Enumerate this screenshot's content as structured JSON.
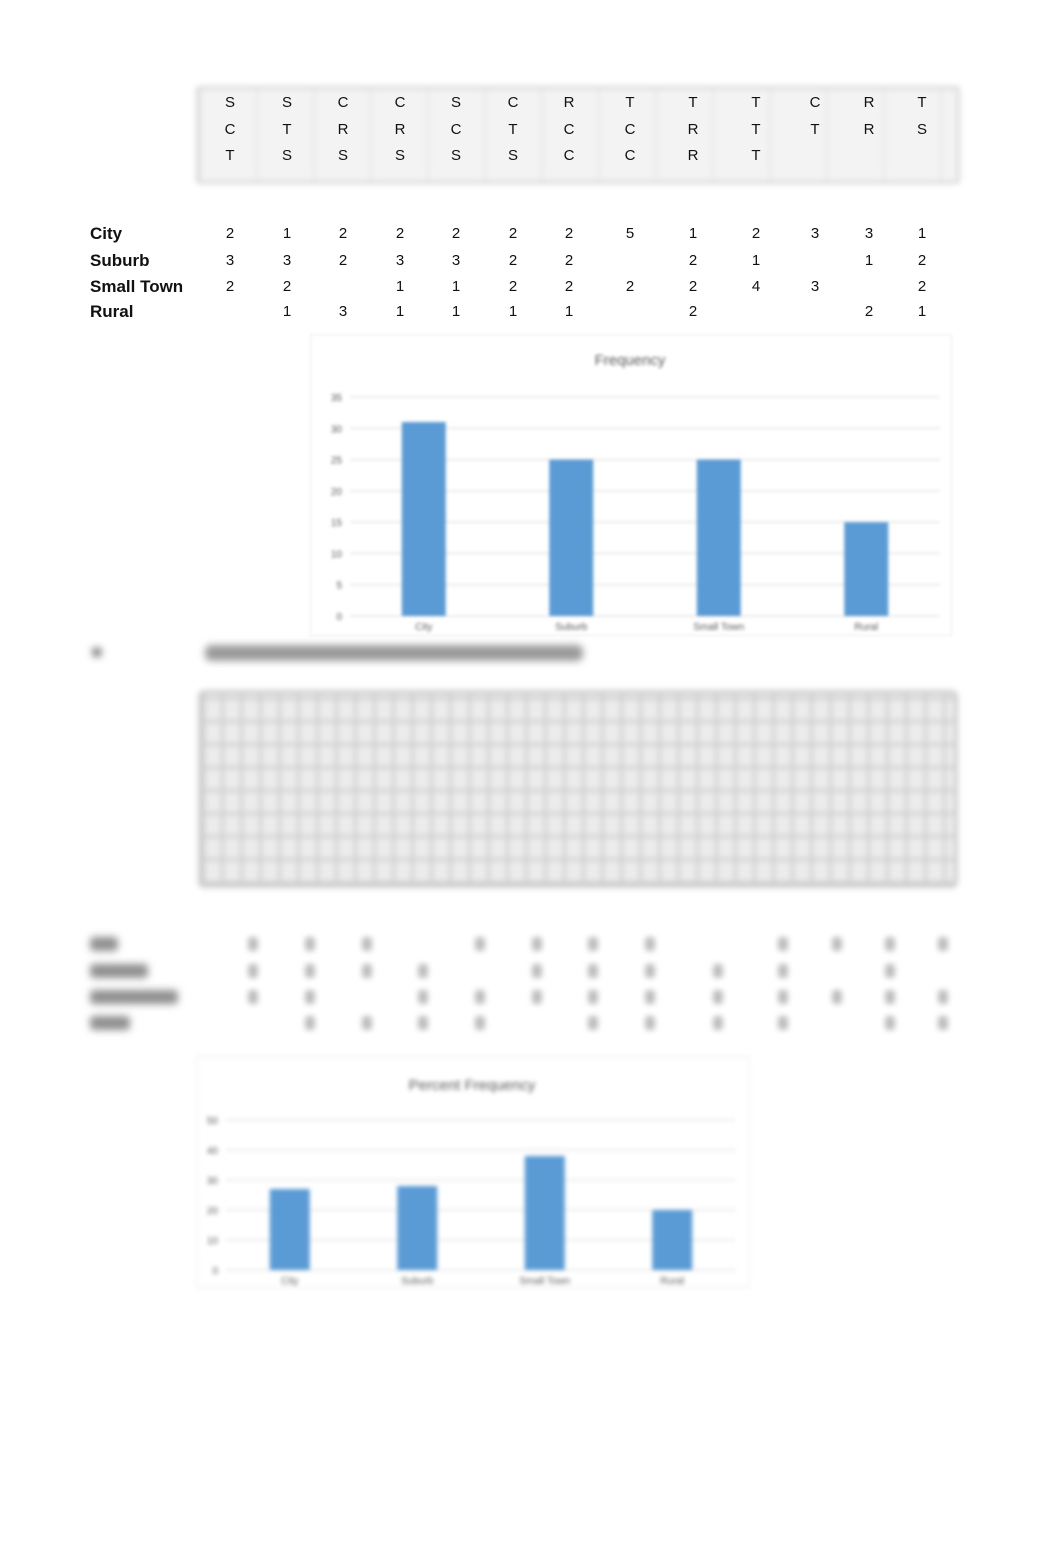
{
  "letter_grid": {
    "rows": [
      [
        "S",
        "S",
        "C",
        "C",
        "S",
        "C",
        "R",
        "T",
        "T",
        "T",
        "C",
        "R",
        "T"
      ],
      [
        "C",
        "T",
        "R",
        "R",
        "C",
        "T",
        "C",
        "C",
        "R",
        "T",
        "T",
        "R",
        "S"
      ],
      [
        "T",
        "S",
        "S",
        "S",
        "S",
        "S",
        "C",
        "C",
        "R",
        "T",
        "",
        "",
        ""
      ]
    ]
  },
  "count_table": {
    "rows": [
      {
        "label": "City",
        "values": [
          "2",
          "1",
          "2",
          "2",
          "2",
          "2",
          "2",
          "5",
          "1",
          "2",
          "3",
          "3",
          "1"
        ]
      },
      {
        "label": "Suburb",
        "values": [
          "3",
          "3",
          "2",
          "3",
          "3",
          "2",
          "2",
          "",
          "2",
          "1",
          "",
          "1",
          "2"
        ]
      },
      {
        "label": "Small Town",
        "values": [
          "2",
          "2",
          "",
          "1",
          "1",
          "2",
          "2",
          "2",
          "2",
          "4",
          "3",
          "",
          "2"
        ]
      },
      {
        "label": "Rural",
        "values": [
          "",
          "1",
          "3",
          "1",
          "1",
          "1",
          "1",
          "",
          "2",
          "",
          "",
          "2",
          "1"
        ]
      }
    ]
  },
  "chart_data": [
    {
      "type": "bar",
      "title": "Frequency",
      "categories": [
        "City",
        "Suburb",
        "Small Town",
        "Rural"
      ],
      "values": [
        31,
        25,
        25,
        15
      ],
      "xlabel": "",
      "ylabel": "",
      "ylim": [
        0,
        35
      ],
      "yticks": [
        0,
        5,
        10,
        15,
        20,
        25,
        30,
        35
      ],
      "grid": true,
      "color": "#5b9bd5"
    },
    {
      "type": "bar",
      "title": "Percent Frequency",
      "categories": [
        "City",
        "Suburb",
        "Small Town",
        "Rural"
      ],
      "values": [
        27,
        28,
        38,
        20
      ],
      "xlabel": "",
      "ylabel": "",
      "ylim": [
        0,
        50
      ],
      "yticks": [
        0,
        10,
        20,
        30,
        40,
        50
      ],
      "grid": true,
      "color": "#5b9bd5"
    }
  ],
  "blurred_section": {
    "count_table_labels": [
      "City",
      "Suburb",
      "Small Town",
      "Rural"
    ],
    "count_table_presence": [
      [
        1,
        1,
        1,
        0,
        1,
        1,
        1,
        1,
        0,
        1,
        1,
        1,
        1
      ],
      [
        1,
        1,
        1,
        1,
        0,
        1,
        1,
        1,
        1,
        1,
        0,
        1,
        0
      ],
      [
        1,
        1,
        0,
        1,
        1,
        1,
        1,
        1,
        1,
        1,
        1,
        1,
        1
      ],
      [
        0,
        1,
        1,
        1,
        1,
        0,
        1,
        1,
        1,
        1,
        0,
        1,
        1
      ]
    ]
  }
}
